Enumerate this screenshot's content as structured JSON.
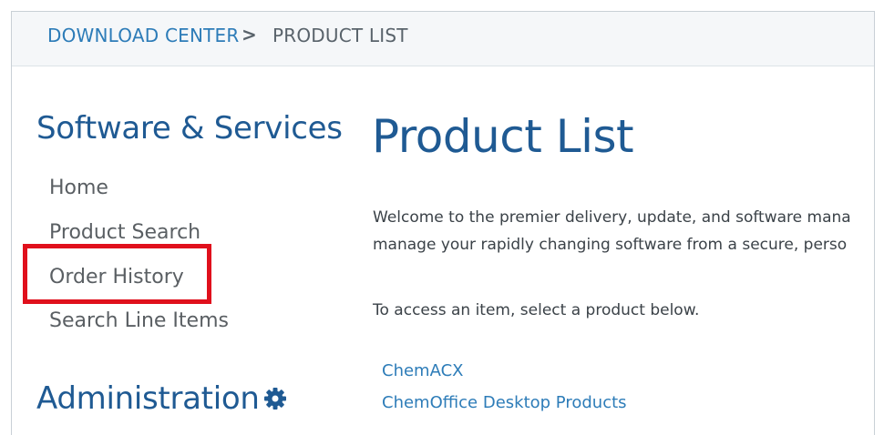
{
  "breadcrumb": {
    "root": "DOWNLOAD CENTER",
    "separator": ">",
    "current": "PRODUCT LIST"
  },
  "sidebar": {
    "title": "Software & Services",
    "items": [
      {
        "label": "Home"
      },
      {
        "label": "Product Search"
      },
      {
        "label": "Order History"
      },
      {
        "label": "Search Line Items"
      }
    ],
    "admin_title": "Administration",
    "admin_icon": "gear-icon"
  },
  "main": {
    "title": "Product List",
    "intro_line1": "Welcome to the premier delivery, update, and software mana",
    "intro_line2": "manage your rapidly changing software from a secure, perso",
    "instruction": "To access an item, select a product below.",
    "products": [
      {
        "label": "ChemACX"
      },
      {
        "label": "ChemOffice Desktop Products"
      }
    ]
  },
  "colors": {
    "heading": "#1f5a93",
    "link": "#2d7cb8",
    "highlight": "#e0101c"
  }
}
